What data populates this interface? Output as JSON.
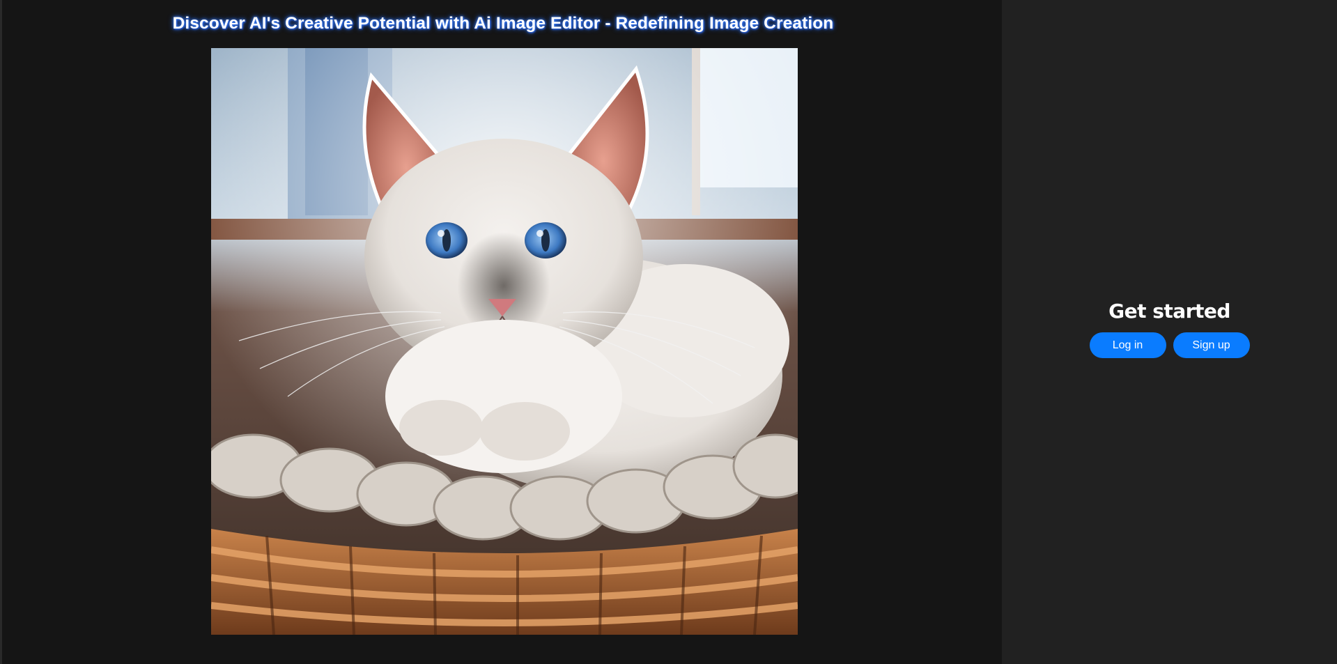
{
  "main": {
    "headline": "Discover AI's Creative Potential with Ai Image Editor - Redefining Image Creation",
    "hero_image": {
      "subject": "white cat with blue eyes in woven basket"
    }
  },
  "auth": {
    "title": "Get started",
    "login_label": "Log in",
    "signup_label": "Sign up"
  },
  "colors": {
    "left_background": "#151515",
    "right_background": "#212121",
    "button": "#0a7cff",
    "headline_glow": "#3b82f6"
  }
}
